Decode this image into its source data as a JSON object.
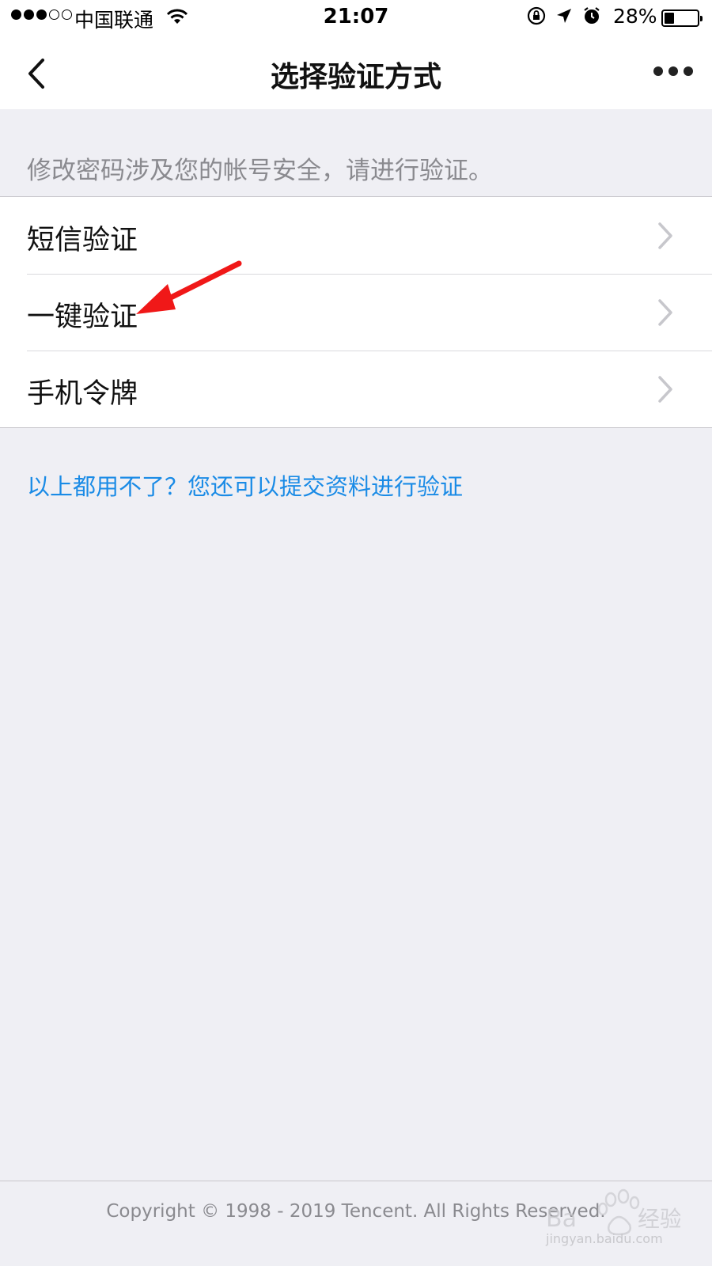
{
  "status_bar": {
    "carrier": "中国联通",
    "time": "21:07",
    "battery_percent": "28%",
    "battery_level": 0.28,
    "signal_full_dots": 3,
    "signal_total_dots": 5,
    "icons": [
      "orientation-lock-icon",
      "location-arrow-icon",
      "alarm-icon"
    ]
  },
  "nav": {
    "title": "选择验证方式",
    "back_icon": "chevron-left-icon",
    "more_icon": "more-dots-icon"
  },
  "notice": "修改密码涉及您的帐号安全，请进行验证。",
  "methods": [
    {
      "label": "短信验证"
    },
    {
      "label": "一键验证"
    },
    {
      "label": "手机令牌"
    }
  ],
  "alt_link": "以上都用不了？您还可以提交资料进行验证",
  "footer": {
    "copyright": "Copyright © 1998 - 2019 Tencent. All Rights Reserved."
  },
  "watermark": {
    "text": "Baidu经验",
    "url": "jingyan.baidu.com"
  },
  "colors": {
    "background": "#efeff4",
    "link": "#1a8be6",
    "annotation_arrow": "#f01818"
  }
}
